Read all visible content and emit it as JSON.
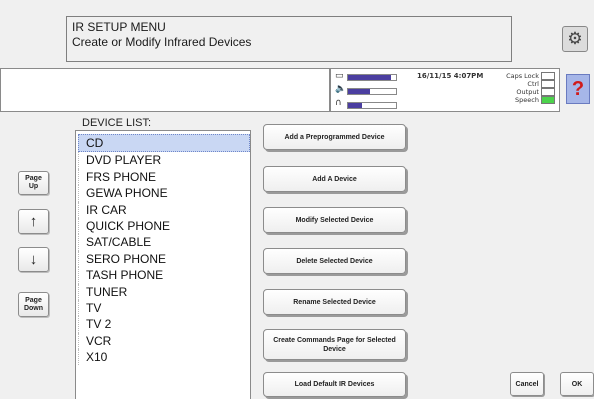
{
  "header": {
    "line1": "IR SETUP MENU",
    "line2": "Create or Modify Infrared Devices",
    "settings_icon": "gear-icon"
  },
  "status": {
    "message": "",
    "datetime": "16/11/15 4:07PM",
    "battery_level": 0.9,
    "volume_level": 0.45,
    "headphone_level": 0.3,
    "locks": [
      {
        "label": "Caps Lock",
        "on": false
      },
      {
        "label": "Ctrl",
        "on": false
      },
      {
        "label": "Output",
        "on": false
      },
      {
        "label": "Speech",
        "on": true
      }
    ],
    "speech_color": "#4cd34c"
  },
  "help": {
    "label": "?"
  },
  "device_list": {
    "label": "DEVICE LIST:",
    "items": [
      "CD",
      "DVD PLAYER",
      "FRS PHONE",
      "GEWA PHONE",
      "IR CAR",
      "QUICK PHONE",
      "SAT/CABLE",
      "SERO PHONE",
      "TASH PHONE",
      "TUNER",
      "TV",
      "TV 2",
      "VCR",
      "X10"
    ],
    "selected_index": 0,
    "selected_color": "#c9d7f3"
  },
  "nav": {
    "page_up": "Page\nUp",
    "up_arrow": "↑",
    "down_arrow": "↓",
    "page_down": "Page\nDown"
  },
  "actions": [
    "Add a Preprogrammed Device",
    "Add A Device",
    "Modify Selected Device",
    "Delete Selected Device",
    "Rename Selected Device",
    "Create Commands Page for Selected Device",
    "Load Default IR Devices"
  ],
  "footer": {
    "cancel": "Cancel",
    "ok": "OK"
  },
  "colors": {
    "help_bg": "#a6b6e8",
    "help_fg": "#d01b1b",
    "meter": "#4b3ea0"
  }
}
